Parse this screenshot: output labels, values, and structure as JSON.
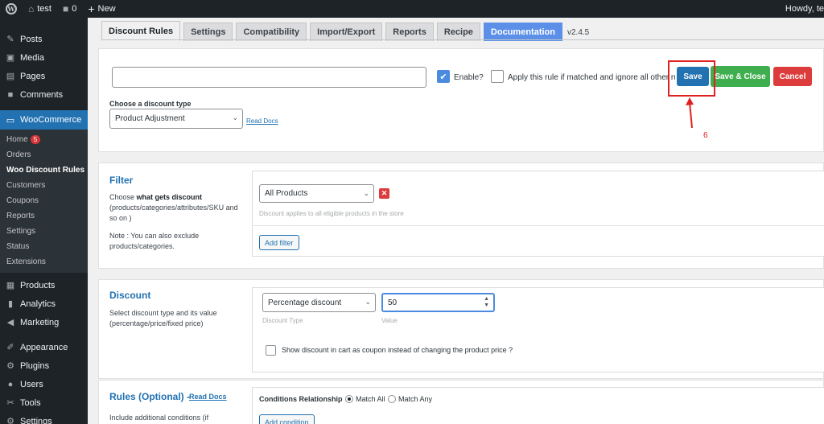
{
  "adminbar": {
    "site_name": "test",
    "comments_count": "0",
    "new_label": "New",
    "howdy": "Howdy, te"
  },
  "sidebar": {
    "top_items": [
      {
        "label": "Posts",
        "icon": "pin-icon"
      },
      {
        "label": "Media",
        "icon": "media-icon"
      },
      {
        "label": "Pages",
        "icon": "pages-icon"
      },
      {
        "label": "Comments",
        "icon": "comments-icon"
      }
    ],
    "woocommerce": "WooCommerce",
    "sub_items": [
      {
        "label": "Home",
        "badge": "5"
      },
      {
        "label": "Orders"
      },
      {
        "label": "Woo Discount Rules"
      },
      {
        "label": "Customers"
      },
      {
        "label": "Coupons"
      },
      {
        "label": "Reports"
      },
      {
        "label": "Settings"
      },
      {
        "label": "Status"
      },
      {
        "label": "Extensions"
      }
    ],
    "bottom_items": [
      {
        "label": "Products",
        "icon": "products-icon"
      },
      {
        "label": "Analytics",
        "icon": "analytics-icon"
      },
      {
        "label": "Marketing",
        "icon": "marketing-icon"
      },
      {
        "label": "Appearance",
        "icon": "appearance-icon"
      },
      {
        "label": "Plugins",
        "icon": "plugins-icon"
      },
      {
        "label": "Users",
        "icon": "users-icon"
      },
      {
        "label": "Tools",
        "icon": "tools-icon"
      },
      {
        "label": "Settings",
        "icon": "settings-icon"
      }
    ]
  },
  "tabs": [
    "Discount Rules",
    "Settings",
    "Compatibility",
    "Import/Export",
    "Reports",
    "Recipe",
    "Documentation"
  ],
  "version": "v2.4.5",
  "rule": {
    "name_value": "",
    "enable_label": "Enable?",
    "apply_label": "Apply this rule if matched and ignore all other rules",
    "save": "Save",
    "save_close": "Save & Close",
    "cancel": "Cancel",
    "annotation_number": "6",
    "discount_type_title": "Choose a discount type",
    "discount_type_value": "Product Adjustment",
    "read_docs": "Read Docs"
  },
  "filter": {
    "title": "Filter",
    "desc_prefix": "Choose ",
    "desc_bold": "what gets discount",
    "desc_rest": "(products/categories/attributes/SKU and so on )",
    "note": "Note : You can also exclude products/categories.",
    "select_value": "All Products",
    "hint": "Discount applies to all eligible products in the store",
    "add_filter": "Add filter"
  },
  "discount": {
    "title": "Discount",
    "desc": "Select discount type and its value (percentage/price/fixed price)",
    "type_value": "Percentage discount",
    "type_label": "Discount Type",
    "value": "50",
    "value_label": "Value",
    "coupon_label": "Show discount in cart as coupon instead of changing the product price ?"
  },
  "rules": {
    "title": "Rules (Optional) -",
    "read_docs": "Read Docs",
    "desc": "Include additional conditions (if",
    "relationship_label": "Conditions Relationship",
    "match_all": "Match All",
    "match_any": "Match Any",
    "add_condition": "Add condition"
  },
  "colors": {
    "primary": "#2271b1",
    "success": "#3fae4f",
    "danger": "#dc3c3c",
    "annotation": "#e02020"
  }
}
